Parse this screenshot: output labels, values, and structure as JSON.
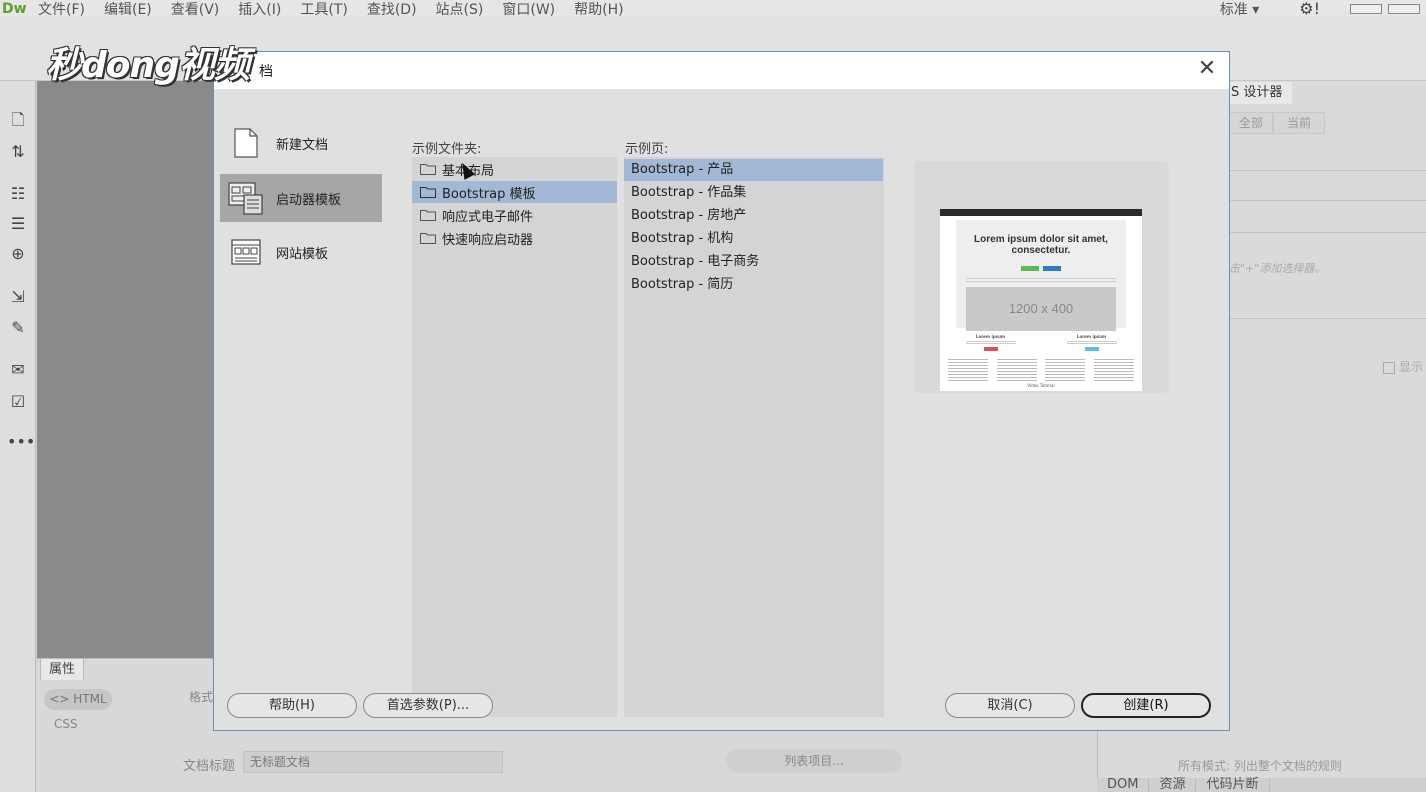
{
  "app": {
    "logo": "Dw",
    "menu": [
      "文件(F)",
      "编辑(E)",
      "查看(V)",
      "插入(I)",
      "工具(T)",
      "查找(D)",
      "站点(S)",
      "窗口(W)",
      "帮助(H)"
    ],
    "workspace_mode": "标准",
    "workspace_caret": "▾",
    "gear": "⚙!"
  },
  "watermark": "秒dong视频",
  "properties_panel": {
    "tab": "属性",
    "html_btn": "<> HTML",
    "css_btn": "CSS",
    "format_label": "格式",
    "doc_title_label": "文档标题",
    "doc_title_value": "无标题文档",
    "list_item_btn": "列表项目..."
  },
  "right_panel": {
    "tab": "S 设计器",
    "seg_all": "全部",
    "seg_current": "当前",
    "hint": "击\"+\"添加选择器。",
    "show_checkbox": "显示",
    "all_mode": "所有模式: 列出整个文档的规则",
    "bottom_tabs": [
      "DOM",
      "资源",
      "代码片断"
    ]
  },
  "dialog": {
    "title": "档",
    "close_glyph": "✕",
    "categories": [
      {
        "label": "新建文档",
        "icon": "blank-document-icon",
        "selected": false
      },
      {
        "label": "启动器模板",
        "icon": "starter-template-icon",
        "selected": true
      },
      {
        "label": "网站模板",
        "icon": "site-template-icon",
        "selected": false
      }
    ],
    "folder_column_label": "示例文件夹:",
    "folders": [
      {
        "label": "基本布局",
        "selected": false
      },
      {
        "label": "Bootstrap 模板",
        "selected": true
      },
      {
        "label": "响应式电子邮件",
        "selected": false
      },
      {
        "label": "快速响应启动器",
        "selected": false
      }
    ],
    "page_column_label": "示例页:",
    "pages": [
      {
        "label": "Bootstrap - 产品",
        "selected": true
      },
      {
        "label": "Bootstrap - 作品集",
        "selected": false
      },
      {
        "label": "Bootstrap - 房地产",
        "selected": false
      },
      {
        "label": "Bootstrap - 机构",
        "selected": false
      },
      {
        "label": "Bootstrap - 电子商务",
        "selected": false
      },
      {
        "label": "Bootstrap - 简历",
        "selected": false
      }
    ],
    "preview": {
      "heading": "Lorem ipsum dolor sit amet, consectetur.",
      "placeholder": "1200 x 400",
      "col_title": "Lorem ipsum",
      "footer": "Video Tutorial"
    },
    "buttons": {
      "help": "帮助(H)",
      "preferences": "首选参数(P)...",
      "cancel": "取消(C)",
      "create": "创建(R)"
    }
  }
}
